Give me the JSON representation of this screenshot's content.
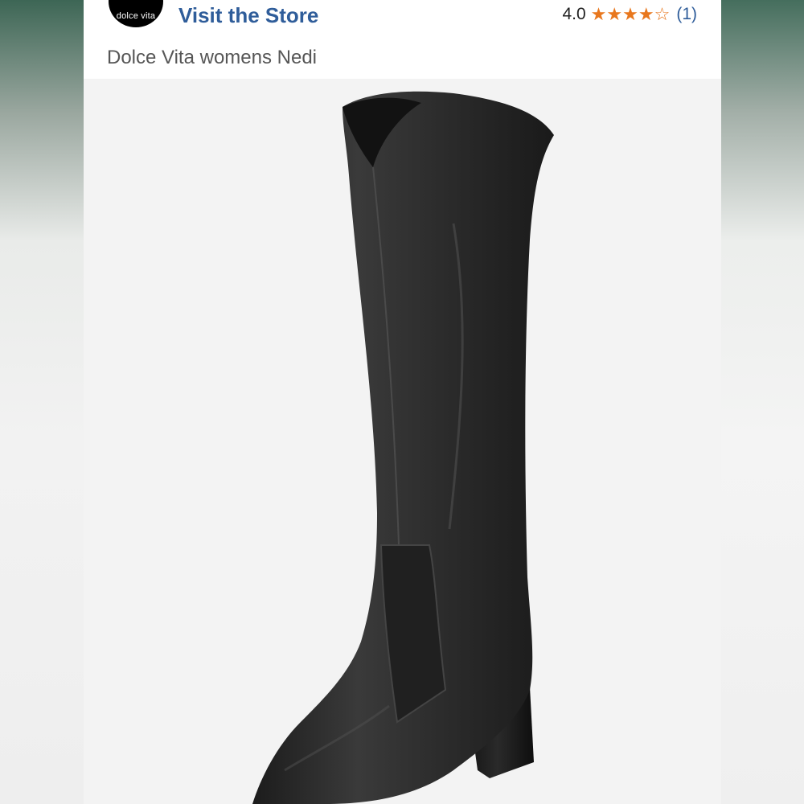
{
  "brand": {
    "logo_text": "dolce vita",
    "visit_store_label": "Visit the Store"
  },
  "rating": {
    "value": "4.0",
    "stars": 4,
    "max_stars": 5,
    "review_count": "(1)",
    "star_color": "#e8771d"
  },
  "product": {
    "title": "Dolce Vita womens Nedi",
    "image_icon": "black-knee-high-boot"
  },
  "colors": {
    "link": "#2f5d9a",
    "title_text": "#565656",
    "image_background": "#f3f3f3",
    "boot": "#2a2a2a"
  }
}
